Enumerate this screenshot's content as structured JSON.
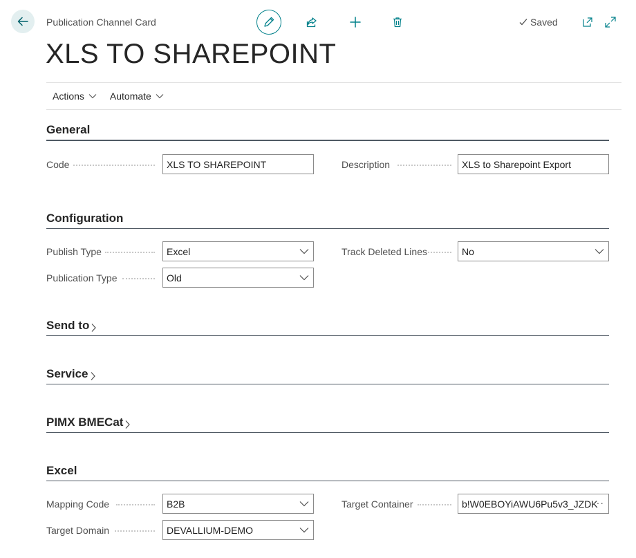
{
  "header": {
    "page_caption": "Publication Channel Card",
    "saved_label": "Saved",
    "record_title": "XLS TO SHAREPOINT"
  },
  "actionbar": {
    "actions_label": "Actions",
    "automate_label": "Automate"
  },
  "sections": {
    "general": {
      "title": "General",
      "code_label": "Code",
      "code_value": "XLS TO SHAREPOINT",
      "description_label": "Description",
      "description_value": "XLS to Sharepoint Export"
    },
    "configuration": {
      "title": "Configuration",
      "publish_type_label": "Publish Type",
      "publish_type_value": "Excel",
      "track_deleted_label": "Track Deleted Lines",
      "track_deleted_value": "No",
      "publication_type_label": "Publication Type",
      "publication_type_value": "Old"
    },
    "send_to": {
      "title": "Send to"
    },
    "service": {
      "title": "Service"
    },
    "pimx": {
      "title": "PIMX BMECat"
    },
    "excel": {
      "title": "Excel",
      "mapping_code_label": "Mapping Code",
      "mapping_code_value": "B2B",
      "target_container_label": "Target Container",
      "target_container_value": "b!W0EBOYiAWU6Pu5v3_JZDK",
      "target_domain_label": "Target Domain",
      "target_domain_value": "DEVALLIUM-DEMO"
    }
  },
  "icons": {
    "back": "arrow-left-icon",
    "edit": "pencil-icon",
    "share": "share-icon",
    "new": "plus-icon",
    "delete": "trash-icon",
    "saved": "check-icon",
    "open_new": "open-new-window-icon",
    "expand": "expand-icon"
  },
  "colors": {
    "accent": "#00808a",
    "text": "#212121",
    "muted": "#505050"
  }
}
